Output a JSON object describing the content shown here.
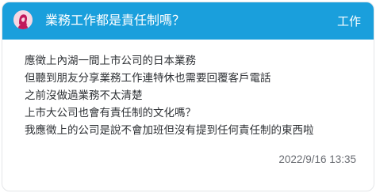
{
  "post": {
    "title": "業務工作都是責任制嗎？",
    "board": "工作",
    "avatar_icon": "female-avatar-icon",
    "body_lines": [
      "應徵上內湖一間上市公司的日本業務",
      "但聽到朋友分享業務工作連特休也需要回覆客戶電話",
      "之前沒做過業務不太清楚",
      "上市大公司也會有責任制的文化嗎？",
      "我應徵上的公司是說不會加班但沒有提到任何責任制的東西啦"
    ],
    "timestamp": "2022/9/16 13:35"
  },
  "colors": {
    "header_background": "#1a9fdc",
    "header_text": "#ffffff",
    "avatar_background": "#f7d7e2",
    "avatar_figure": "#c2185b",
    "body_text": "#2e3135",
    "timestamp_text": "#6a6d73"
  }
}
